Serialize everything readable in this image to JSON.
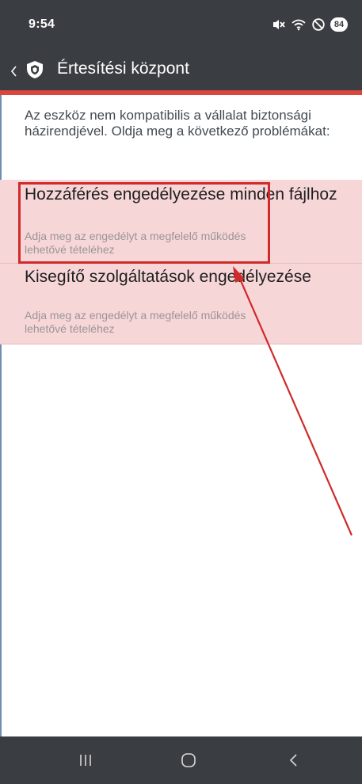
{
  "status_bar": {
    "time": "9:54",
    "battery": "84",
    "icons": [
      "mute-icon",
      "wifi-icon",
      "do-not-disturb-icon"
    ]
  },
  "app_bar": {
    "title": "Értesítési központ",
    "back_icon": "chevron-left-icon",
    "logo_icon": "shield-icon"
  },
  "content": {
    "intro": "Az eszköz nem kompatibilis a vállalat biztonsági házirendjével. Oldja meg a következő problémákat:",
    "issues": [
      {
        "title": "Hozzáférés engedélyezése minden fájlhoz",
        "description": "Adja meg az engedélyt a megfelelő működés lehetővé tételéhez"
      },
      {
        "title": "Kisegítő szolgáltatások engedélyezése",
        "description": "Adja meg az engedélyt a megfelelő működés lehetővé tételéhez"
      }
    ]
  },
  "nav_bar": {
    "icons": [
      "recents-icon",
      "home-icon",
      "back-icon"
    ]
  },
  "colors": {
    "bar_bg": "#3a3e42",
    "accent": "#d9473f",
    "issue_bg": "#f7d6d8",
    "annotation": "#d02a2a"
  }
}
